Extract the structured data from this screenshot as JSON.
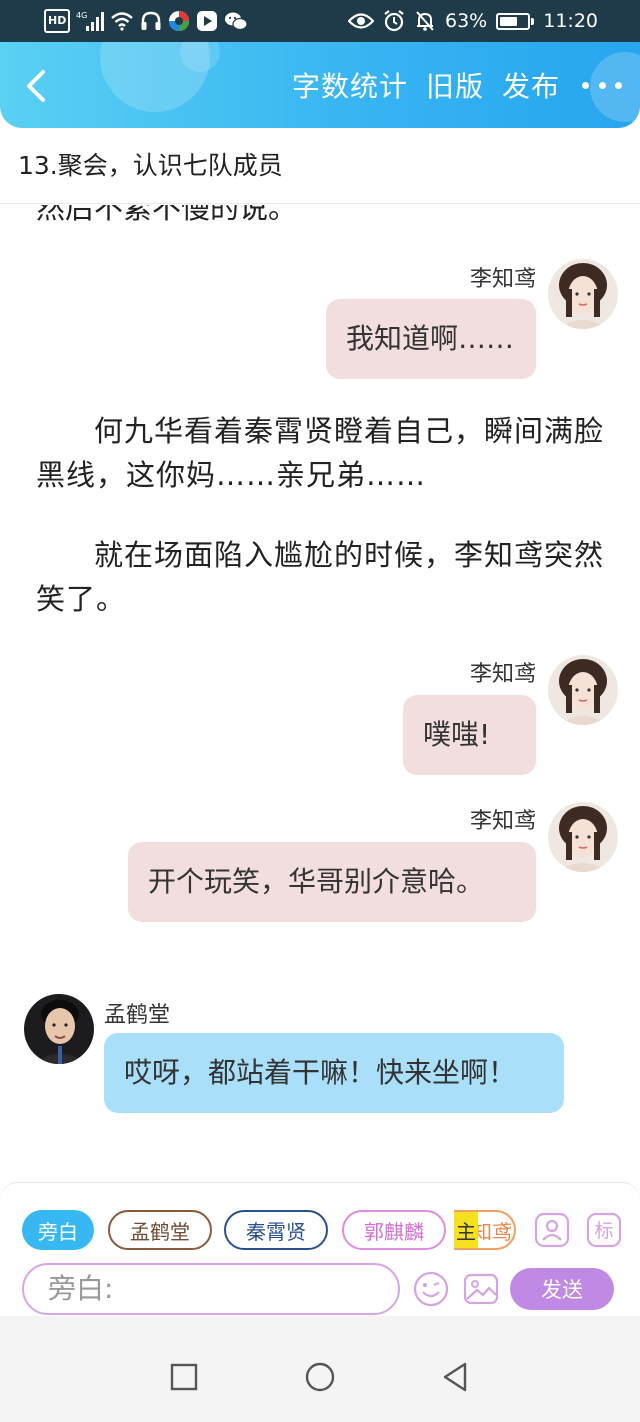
{
  "status_bar": {
    "hd": "HD",
    "network": "4G",
    "battery_percent": "63%",
    "battery_level": 0.63,
    "time": "11:20",
    "icons": [
      "hd-icon",
      "signal-icon",
      "wifi-icon",
      "headphones-icon",
      "app-icon",
      "play-icon",
      "wechat-icon",
      "eye-icon",
      "alarm-icon",
      "mute-icon",
      "battery-icon"
    ]
  },
  "header": {
    "back_icon": "chevron-left-icon",
    "word_count": "字数统计",
    "old_version": "旧版",
    "publish": "发布",
    "more_icon": "more-dots-icon"
  },
  "chapter": {
    "title": "13.聚会，认识七队成员"
  },
  "content": {
    "cut_line": "然后不紧不慢的说。",
    "messages": [
      {
        "speaker": "李知鸢",
        "text": "我知道啊……"
      },
      {
        "narration": "何九华看着秦霄贤瞪着自己，瞬间满脸黑线，这你妈……亲兄弟……"
      },
      {
        "narration": "就在场面陷入尴尬的时候，李知鸢突然笑了。"
      },
      {
        "speaker": "李知鸢",
        "text": "噗嗤!"
      },
      {
        "speaker": "李知鸢",
        "text": "开个玩笑，华哥别介意哈。"
      },
      {
        "speaker": "孟鹤堂",
        "text": "哎呀，都站着干嘛！快来坐啊！"
      }
    ]
  },
  "toolbar": {
    "chips": [
      "旁白",
      "孟鹤堂",
      "秦霄贤",
      "郭麒麟"
    ],
    "main_tag": "主",
    "li_chip": "李知鸢",
    "tag_label": "标",
    "input_placeholder": "旁白:",
    "send": "发送",
    "colors": {
      "narrator": "#38b8f3",
      "send": "#c08ae4"
    }
  },
  "nav": {
    "icons": [
      "recent-apps-icon",
      "home-icon",
      "back-triangle-icon"
    ]
  }
}
